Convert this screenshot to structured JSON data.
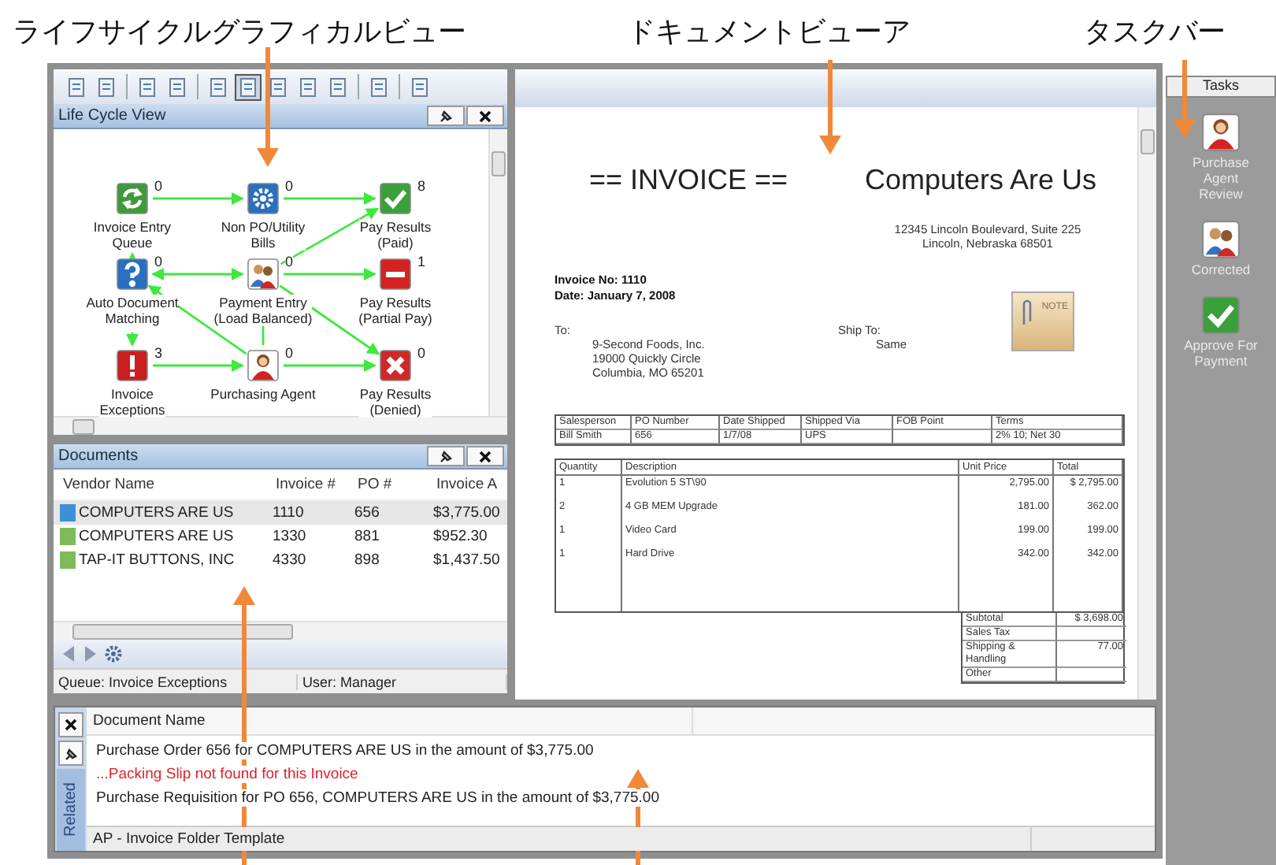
{
  "callouts": [
    {
      "text": "ライフサイクルグラフィカルビュー"
    },
    {
      "text": "ドキュメントビューア"
    },
    {
      "text": "タスクバー"
    }
  ],
  "toolbar": [
    {
      "kind": "button",
      "selected": false
    },
    {
      "kind": "button",
      "selected": false
    },
    {
      "kind": "separator"
    },
    {
      "kind": "button",
      "selected": false
    },
    {
      "kind": "button",
      "selected": false
    },
    {
      "kind": "separator"
    },
    {
      "kind": "button",
      "selected": false
    },
    {
      "kind": "button",
      "selected": true
    },
    {
      "kind": "button",
      "selected": false
    },
    {
      "kind": "button",
      "selected": false
    },
    {
      "kind": "button",
      "selected": false
    },
    {
      "kind": "separator"
    },
    {
      "kind": "button",
      "selected": false
    },
    {
      "kind": "separator"
    },
    {
      "kind": "button",
      "selected": false
    }
  ],
  "lifecycle": {
    "title": "Life Cycle View",
    "nodes": [
      {
        "label": [
          "Invoice Entry",
          "Queue"
        ],
        "count": "0"
      },
      {
        "label": [
          "Non PO/Utility",
          "Bills"
        ],
        "count": "0"
      },
      {
        "label": [
          "Pay Results",
          "(Paid)"
        ],
        "count": "8"
      },
      {
        "label": [
          "Auto Document",
          "Matching"
        ],
        "count": "0"
      },
      {
        "label": [
          "Payment Entry",
          "(Load Balanced)"
        ],
        "count": "0"
      },
      {
        "label": [
          "Pay Results",
          "(Partial Pay)"
        ],
        "count": "1"
      },
      {
        "label": [
          "Invoice",
          "Exceptions"
        ],
        "count": "3"
      },
      {
        "label": [
          "Purchasing Agent"
        ],
        "count": "0"
      },
      {
        "label": [
          "Pay Results",
          "(Denied)"
        ],
        "count": "0"
      }
    ]
  },
  "documents": {
    "title": "Documents",
    "columns": [
      "Vendor Name",
      "Invoice #",
      "PO #",
      "Invoice A"
    ],
    "rows": [
      {
        "cells": [
          "COMPUTERS ARE US",
          "1110",
          "656",
          "$3,775.00"
        ],
        "selected": true,
        "color": "#3d8fd8"
      },
      {
        "cells": [
          "COMPUTERS ARE US",
          "1330",
          "881",
          "$952.30"
        ],
        "selected": false,
        "color": "#7dbb5a"
      },
      {
        "cells": [
          "TAP-IT BUTTONS, INC",
          "4330",
          "898",
          "$1,437.50"
        ],
        "selected": false,
        "color": "#7dbb5a"
      }
    ]
  },
  "status_bar": {
    "queue": "Queue: Invoice Exceptions",
    "user": "User: Manager"
  },
  "invoice": {
    "heading": "== INVOICE ==",
    "company": "Computers Are Us",
    "company_address": [
      "12345 Lincoln Boulevard, Suite 225",
      "Lincoln, Nebraska 68501"
    ],
    "invoice_no": "Invoice No: 1110",
    "date": "Date: January 7, 2008",
    "to_label": "To:",
    "to_address": [
      "9-Second Foods, Inc.",
      "19000 Quickly Circle",
      "Columbia, MO 65201"
    ],
    "ship_to_label": "Ship To:",
    "ship_to": "Same",
    "note": "NOTE",
    "shipping": [
      {
        "header": "Salesperson",
        "value": "Bill Smith"
      },
      {
        "header": "PO Number",
        "value": "656"
      },
      {
        "header": "Date Shipped",
        "value": "1/7/08"
      },
      {
        "header": "Shipped Via",
        "value": "UPS"
      },
      {
        "header": "FOB Point"
      },
      {
        "header": "Terms",
        "value": "2% 10; Net 30"
      }
    ],
    "item_columns": [
      "Quantity",
      "Description",
      "Unit Price",
      "Total"
    ],
    "items": [
      [
        "1",
        "Evolution 5 ST\\90",
        "2,795.00",
        "$ 2,795.00"
      ],
      [
        "2",
        "4 GB MEM Upgrade",
        "181.00",
        "362.00"
      ],
      [
        "1",
        "Video Card",
        "199.00",
        "199.00"
      ],
      [
        "1",
        "Hard Drive",
        "342.00",
        "342.00"
      ]
    ],
    "totals": [
      {
        "label": "Subtotal",
        "value": "$ 3,698.00"
      },
      {
        "label": "Sales Tax"
      },
      {
        "label": "Shipping & Handling",
        "value": "77.00"
      },
      {
        "label": "Other"
      }
    ]
  },
  "related": {
    "tab": "Related",
    "column": "Document Name",
    "rows": [
      {
        "text": "Purchase Order 656 for COMPUTERS ARE US in the amount of $3,775.00",
        "kind": "document"
      },
      {
        "text": "...Packing Slip not found for this Invoice",
        "kind": "warning"
      },
      {
        "text": "Purchase Requisition for PO 656, COMPUTERS ARE US in the amount of $3,775.00",
        "kind": "document"
      }
    ],
    "footer": "AP - Invoice Folder Template"
  },
  "tasks": {
    "title": "Tasks",
    "items": [
      {
        "label": "Purchase Agent Review"
      },
      {
        "label": "Corrected"
      },
      {
        "label": "Approve For Payment"
      }
    ]
  }
}
